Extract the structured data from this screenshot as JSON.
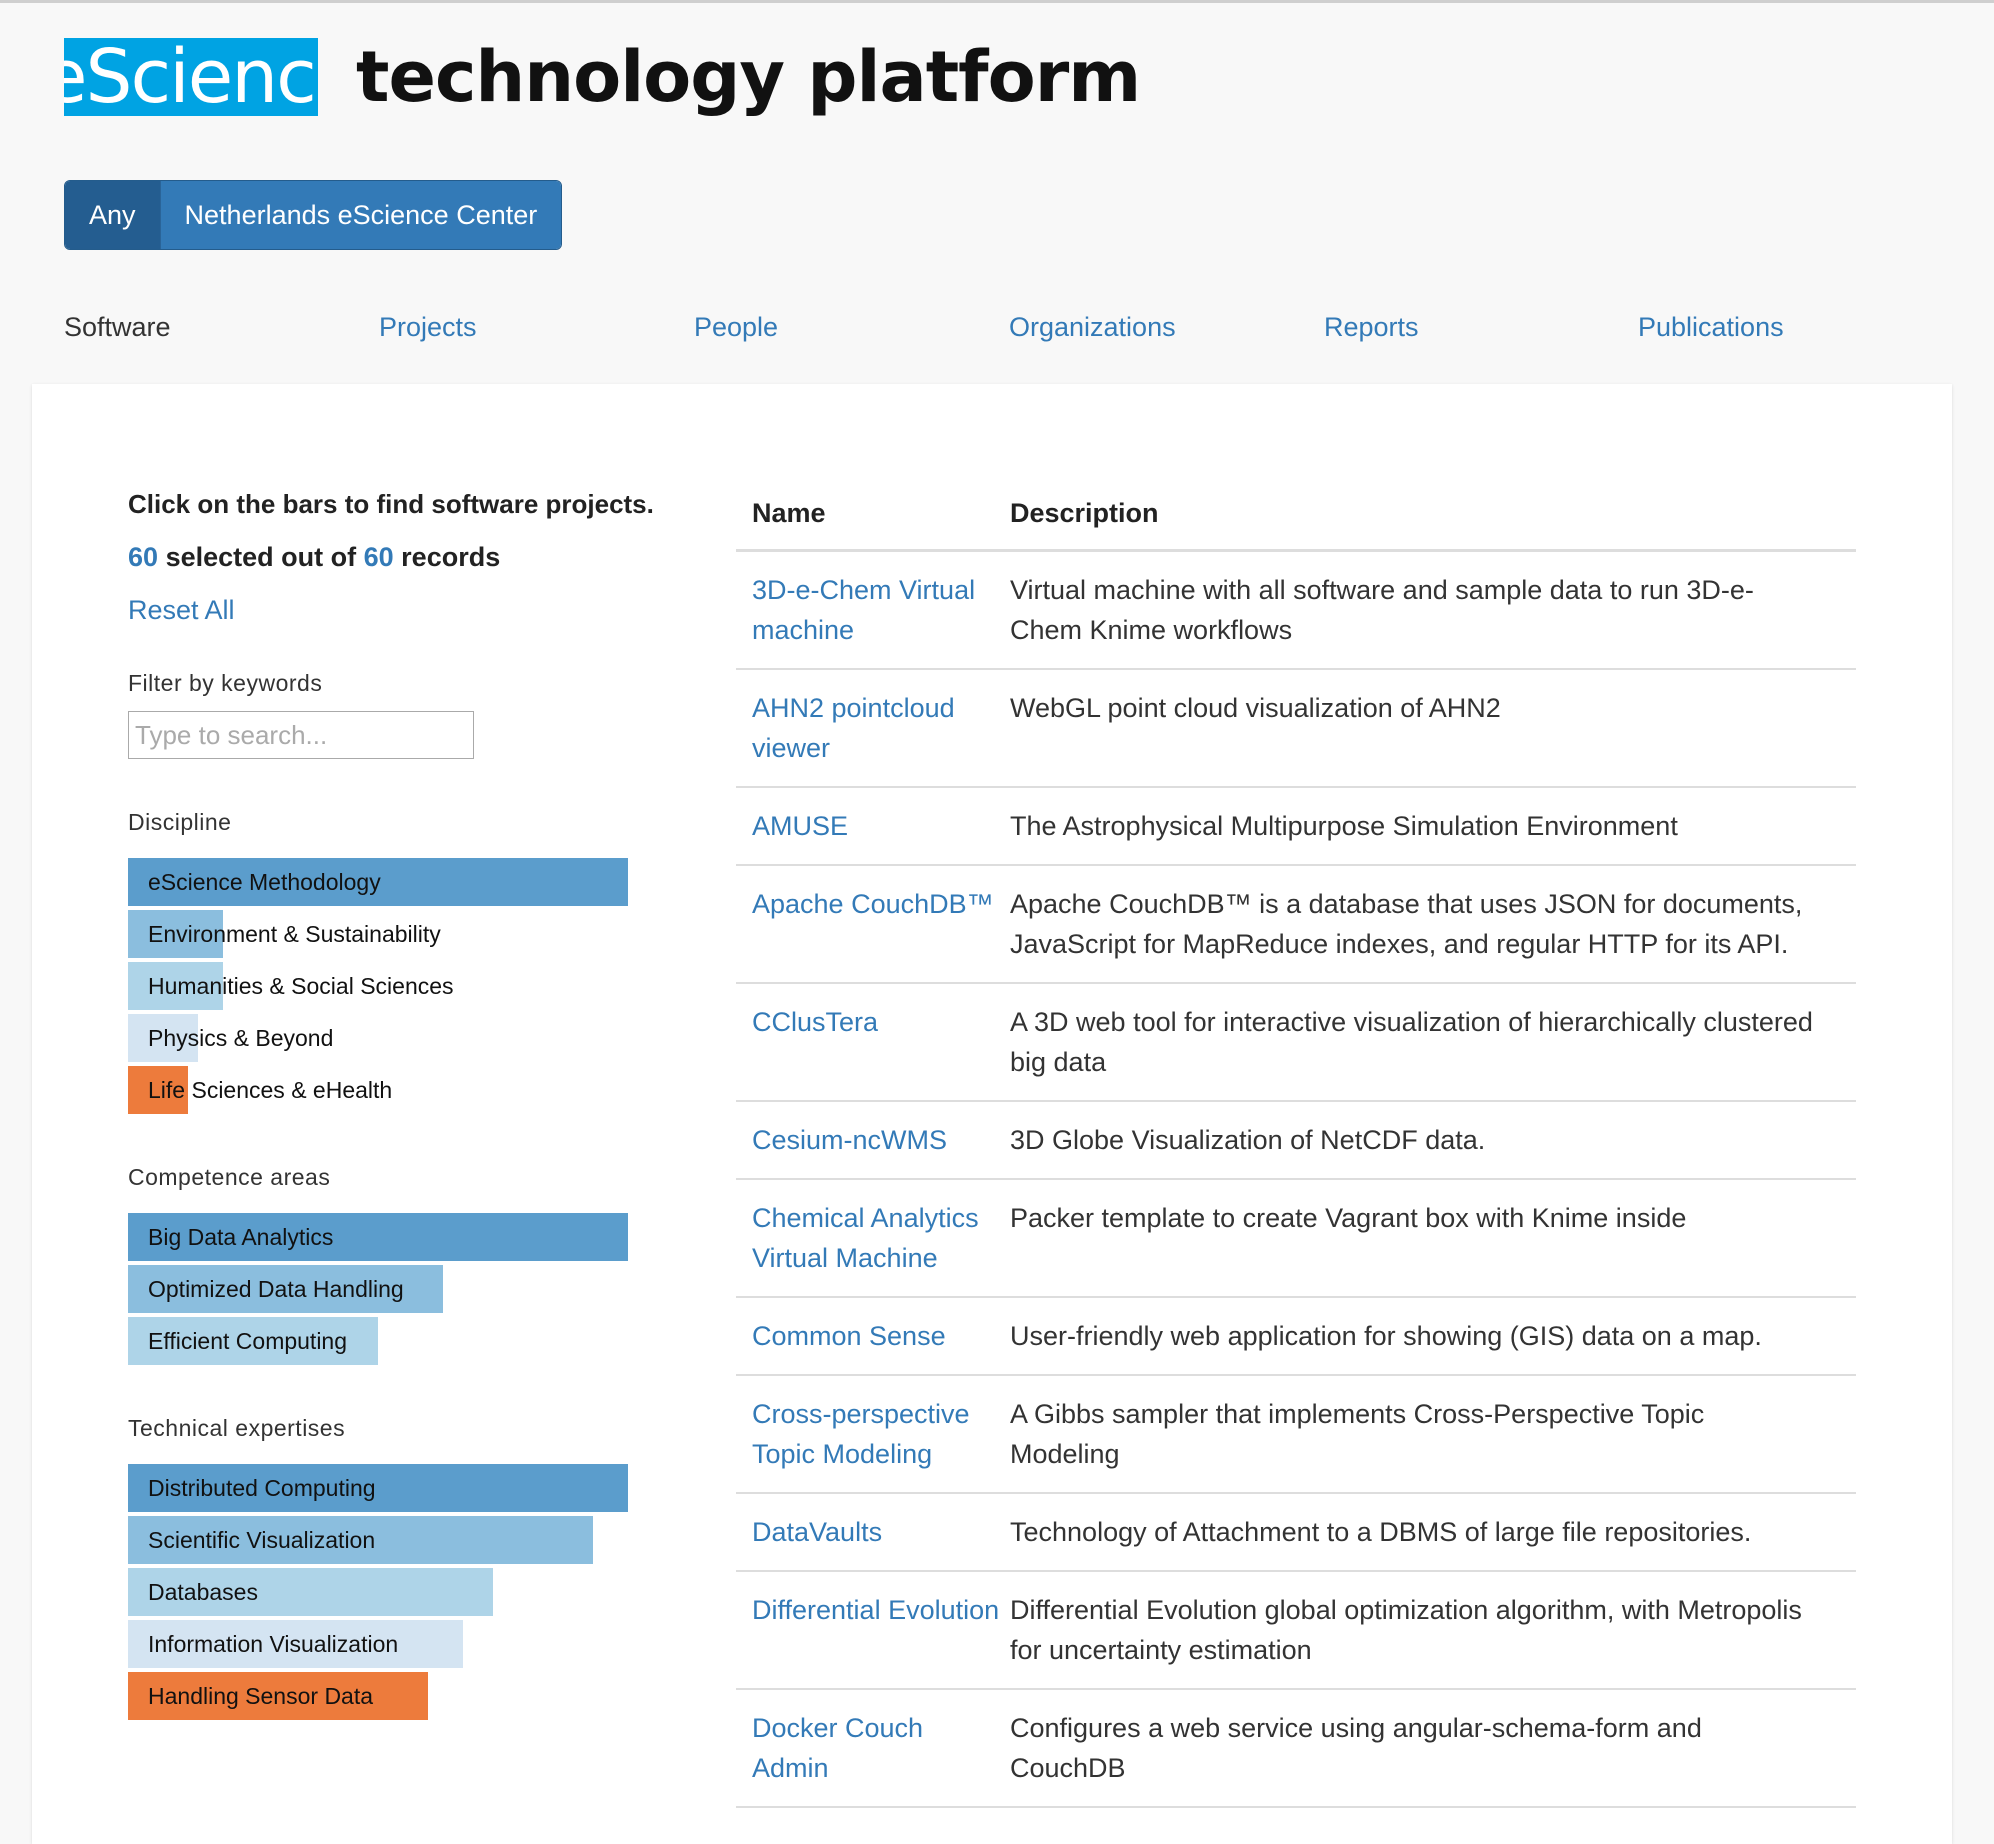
{
  "header": {
    "logo_text": "eScience",
    "title": "technology platform"
  },
  "org_selector": {
    "options": [
      "Any",
      "Netherlands eScience Center"
    ],
    "active": "Any"
  },
  "tabs": [
    {
      "label": "Software",
      "current": true
    },
    {
      "label": "Projects"
    },
    {
      "label": "People"
    },
    {
      "label": "Organizations"
    },
    {
      "label": "Reports"
    },
    {
      "label": "Publications"
    }
  ],
  "sidebar": {
    "intro": "Click on the bars to find software projects.",
    "selected_count": "60",
    "selected_mid": "selected out of",
    "total_count": "60",
    "records_label": "records",
    "reset_label": "Reset All",
    "filter_label": "Filter by keywords",
    "search_placeholder": "Type to search...",
    "facets": [
      {
        "title": "Discipline",
        "bars": [
          {
            "label": "eScience Methodology",
            "value": 1.0,
            "color": "#5b9dcc"
          },
          {
            "label": "Environment & Sustainability",
            "value": 0.19,
            "color": "#8bbede"
          },
          {
            "label": "Humanities & Social Sciences",
            "value": 0.19,
            "color": "#aed4e8"
          },
          {
            "label": "Physics & Beyond",
            "value": 0.14,
            "color": "#d4e4f2"
          },
          {
            "label": "Life Sciences & eHealth",
            "value": 0.12,
            "color": "#ed7b3c"
          }
        ]
      },
      {
        "title": "Competence areas",
        "bars": [
          {
            "label": "Big Data Analytics",
            "value": 1.0,
            "color": "#5b9dcc"
          },
          {
            "label": "Optimized Data Handling",
            "value": 0.63,
            "color": "#8bbede"
          },
          {
            "label": "Efficient Computing",
            "value": 0.5,
            "color": "#aed4e8"
          }
        ]
      },
      {
        "title": "Technical expertises",
        "bars": [
          {
            "label": "Distributed Computing",
            "value": 1.0,
            "color": "#5b9dcc"
          },
          {
            "label": "Scientific Visualization",
            "value": 0.93,
            "color": "#8bbede"
          },
          {
            "label": "Databases",
            "value": 0.73,
            "color": "#aed4e8"
          },
          {
            "label": "Information Visualization",
            "value": 0.67,
            "color": "#d4e4f2"
          },
          {
            "label": "Handling Sensor Data",
            "value": 0.6,
            "color": "#ed7b3c"
          }
        ]
      }
    ]
  },
  "table": {
    "headers": {
      "name": "Name",
      "description": "Description"
    },
    "rows": [
      {
        "name": "3D-e-Chem Virtual machine",
        "description": "Virtual machine with all software and sample data to run 3D-e-Chem Knime workflows"
      },
      {
        "name": "AHN2 pointcloud viewer",
        "description": "WebGL point cloud visualization of AHN2"
      },
      {
        "name": "AMUSE",
        "description": "The Astrophysical Multipurpose Simulation Environment"
      },
      {
        "name": "Apache CouchDB™",
        "description": "Apache CouchDB™ is a database that uses JSON for documents, JavaScript for MapReduce indexes, and regular HTTP for its API."
      },
      {
        "name": "CClusTera",
        "description": "A 3D web tool for interactive visualization of hierarchically clustered big data"
      },
      {
        "name": "Cesium-ncWMS",
        "description": "3D Globe Visualization of NetCDF data."
      },
      {
        "name": "Chemical Analytics Virtual Machine",
        "description": "Packer template to create Vagrant box with Knime inside"
      },
      {
        "name": "Common Sense",
        "description": "User-friendly web application for showing (GIS) data on a map."
      },
      {
        "name": "Cross-perspective Topic Modeling",
        "description": "A Gibbs sampler that implements Cross-Perspective Topic Modeling"
      },
      {
        "name": "DataVaults",
        "description": "Technology of Attachment to a DBMS of large file repositories."
      },
      {
        "name": "Differential Evolution",
        "description": "Differential Evolution global optimization algorithm, with Metropolis for uncertainty estimation"
      },
      {
        "name": "Docker Couch Admin",
        "description": "Configures a web service using angular-schema-form and CouchDB"
      }
    ]
  }
}
